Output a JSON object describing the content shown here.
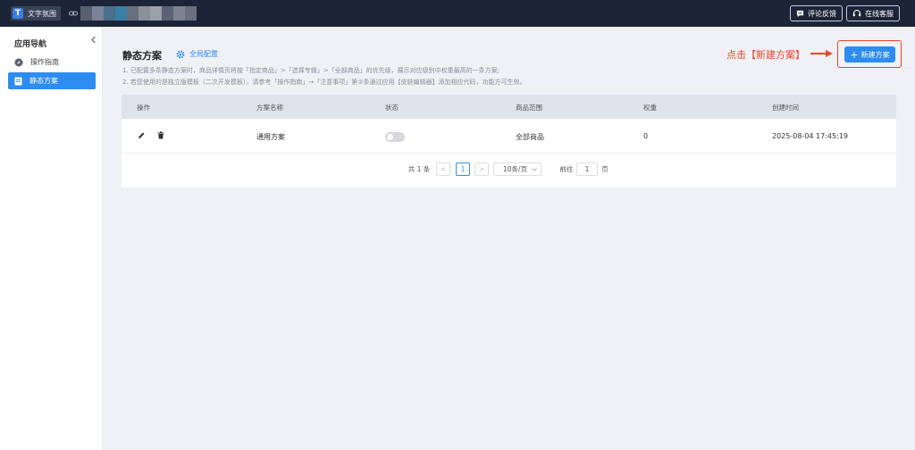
{
  "topbar": {
    "app_name": "文字氛围",
    "blur_colors": [
      "#5a6070",
      "#7a8295",
      "#4a6f8a",
      "#3a7fa8",
      "#6a6f80",
      "#8a8f9a",
      "#9aa0aa",
      "#5a6275",
      "#7c8290",
      "#6a7080"
    ],
    "feedback_label": "评论反馈",
    "service_label": "在线客服"
  },
  "sidebar": {
    "title": "应用导航",
    "items": [
      {
        "label": "操作指南",
        "icon": "compass-icon"
      },
      {
        "label": "静态方案",
        "icon": "document-icon"
      }
    ]
  },
  "main": {
    "title": "静态方案",
    "global_config": "全局配置",
    "tips": [
      "1. 已配置多条静态方案时，商品详情页将按「指定商品」>「选择专辑」>「全部商品」的优先级，展示对应级别中权重最高的一条方案;",
      "2. 若您使用的是独立版模板（二次开发模板），请参考「操作指南」→「注意事项」第②条通过应用【皮肤编辑器】添加相应代码，功能方可生效。"
    ],
    "annotation": "点击【新建方案】",
    "new_button": "新建方案"
  },
  "table": {
    "headers": [
      "操作",
      "方案名称",
      "状态",
      "商品范围",
      "权重",
      "创建时间"
    ],
    "rows": [
      {
        "name": "通用方案",
        "enabled": false,
        "scope": "全部商品",
        "weight": "0",
        "created": "2025-08-04 17:45:19"
      }
    ]
  },
  "pagination": {
    "total": "共 1 条",
    "prev": "<",
    "current": "1",
    "next": ">",
    "page_size": "10条/页",
    "goto_label": "前往",
    "goto_value": "1",
    "page_suffix": "页"
  },
  "colors": {
    "topbar": "#1c2438",
    "accent": "#2d8cf0",
    "annotation": "#e8472c"
  }
}
